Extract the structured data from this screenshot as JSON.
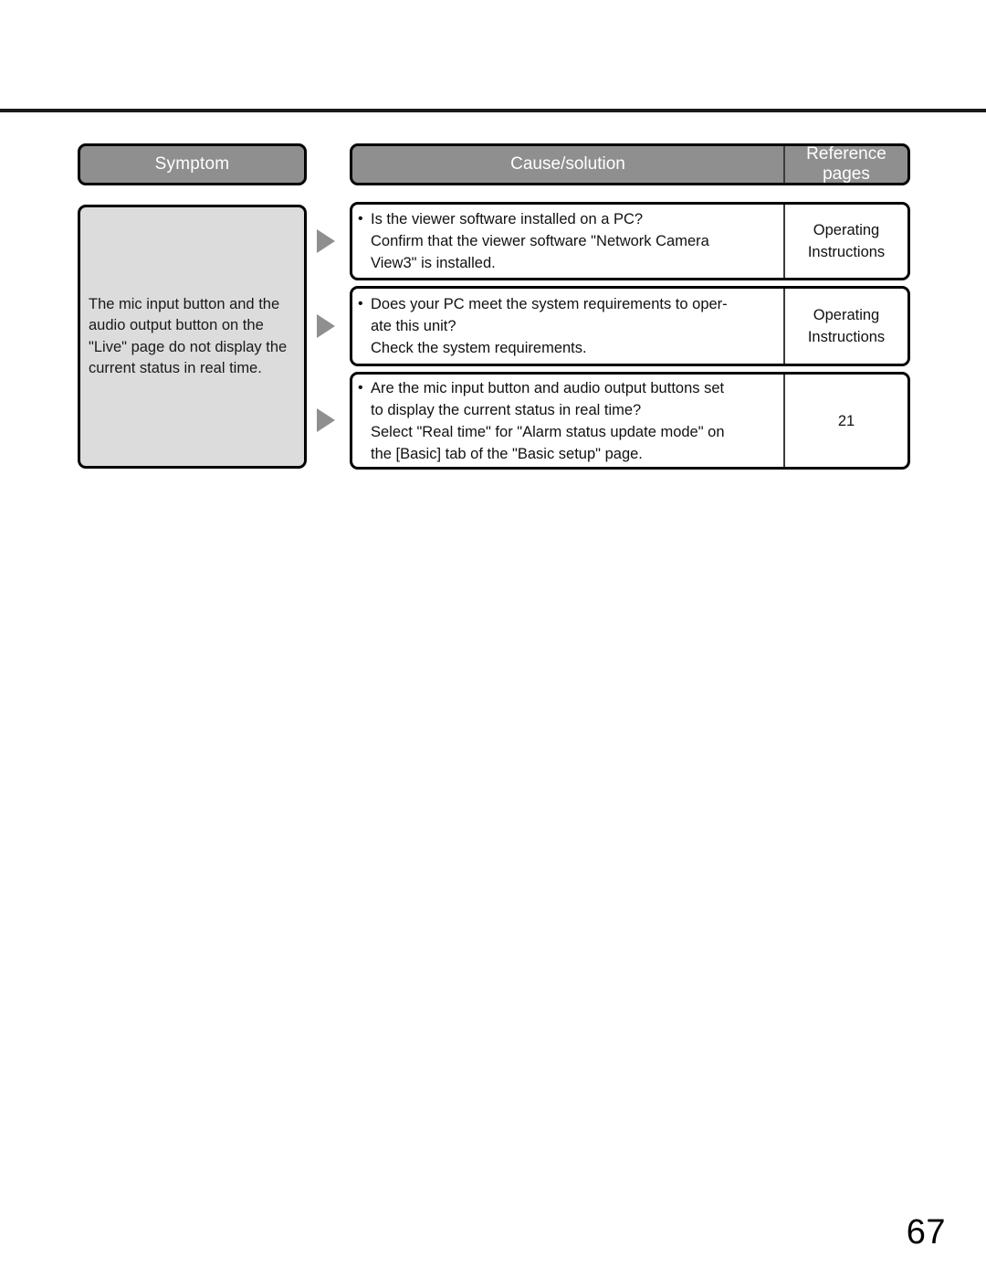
{
  "page": {
    "number": "67"
  },
  "table": {
    "headers": {
      "symptom": "Symptom",
      "cause_solution": "Cause/solution",
      "reference_pages_line1": "Reference",
      "reference_pages_line2": "pages"
    },
    "symptom": {
      "text": "The mic input button and the audio output button on the \"Live\" page do not display the current status in real time."
    },
    "rows": [
      {
        "bullet": "•",
        "lines": [
          "Is the viewer software installed on a PC?",
          "Confirm that the viewer software \"Network Camera",
          "View3\" is installed."
        ],
        "reference": [
          "Operating",
          "Instructions"
        ]
      },
      {
        "bullet": "•",
        "lines": [
          "Does your PC meet the system requirements to oper-",
          "ate this unit?",
          "Check the system requirements."
        ],
        "reference": [
          "Operating",
          "Instructions"
        ]
      },
      {
        "bullet": "•",
        "lines": [
          "Are the mic input button and audio output buttons set",
          "to display the current status in real time?",
          "Select \"Real time\" for \"Alarm status update mode\" on",
          "the [Basic] tab of the \"Basic setup\" page."
        ],
        "reference": [
          "21"
        ]
      }
    ]
  },
  "colors": {
    "header_gray": "#8f8f8f",
    "symptom_fill": "#dcdcdc",
    "arrow_gray": "#8f8f8f",
    "border_black": "#000000"
  }
}
